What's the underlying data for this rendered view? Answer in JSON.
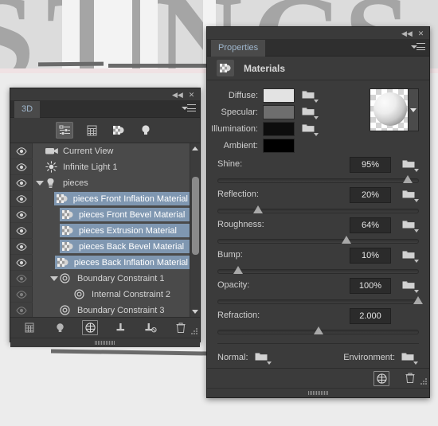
{
  "app": {
    "canvas_letters": [
      "S",
      "T",
      "I",
      "N",
      "G",
      "S"
    ]
  },
  "panel3d": {
    "tab_label": "3D",
    "titlebar": {
      "collapse": "◀◀",
      "close": "✕"
    },
    "filters": [
      {
        "name": "scene-filter-icon",
        "label": "Scene",
        "selected": true
      },
      {
        "name": "mesh-filter-icon",
        "label": "Meshes",
        "selected": false
      },
      {
        "name": "materials-filter-icon",
        "label": "Materials",
        "selected": false
      },
      {
        "name": "lights-filter-icon",
        "label": "Lights",
        "selected": false
      }
    ],
    "rows": [
      {
        "label": "Current View",
        "icon": "camera-icon",
        "type": "normal",
        "indent": 0,
        "visible": true,
        "disclosure": false
      },
      {
        "label": "Infinite Light 1",
        "icon": "light-icon",
        "type": "normal",
        "indent": 0,
        "visible": true,
        "disclosure": false
      },
      {
        "label": "pieces",
        "icon": "mesh-icon",
        "type": "normal",
        "indent": 0,
        "visible": true,
        "disclosure": true
      },
      {
        "label": "pieces Front Inflation Material",
        "icon": "material-icon",
        "type": "material",
        "indent": 1,
        "visible": true,
        "disclosure": false
      },
      {
        "label": "pieces Front Bevel Material",
        "icon": "material-icon",
        "type": "material",
        "indent": 1,
        "visible": true,
        "disclosure": false
      },
      {
        "label": "pieces Extrusion Material",
        "icon": "material-icon",
        "type": "material",
        "indent": 1,
        "visible": true,
        "disclosure": false
      },
      {
        "label": "pieces Back Bevel Material",
        "icon": "material-icon",
        "type": "material",
        "indent": 1,
        "visible": true,
        "disclosure": false
      },
      {
        "label": "pieces Back Inflation Material",
        "icon": "material-icon",
        "type": "material",
        "indent": 1,
        "visible": true,
        "disclosure": false
      },
      {
        "label": "Boundary Constraint 1",
        "icon": "constraint-icon",
        "type": "dim",
        "indent": 1,
        "visible": true,
        "disclosure": true
      },
      {
        "label": "Internal Constraint 2",
        "icon": "constraint-icon",
        "type": "dim",
        "indent": 2,
        "visible": true,
        "disclosure": false
      },
      {
        "label": "Boundary Constraint 3",
        "icon": "constraint-icon",
        "type": "dim",
        "indent": 1,
        "visible": true,
        "disclosure": false
      }
    ],
    "bottom_tools": [
      {
        "name": "add-mesh-icon",
        "label": "Add Mesh",
        "selected": false
      },
      {
        "name": "add-light-icon",
        "label": "Add Light",
        "selected": false
      },
      {
        "name": "environment-icon",
        "label": "Environment",
        "selected": true
      },
      {
        "name": "add-constraint-icon",
        "label": "Add Constraint",
        "selected": false
      },
      {
        "name": "remove-constraint-icon",
        "label": "Remove Constraint",
        "selected": false
      },
      {
        "name": "delete-icon",
        "label": "Delete",
        "selected": false
      }
    ]
  },
  "properties": {
    "tab_label": "Properties",
    "titlebar": {
      "collapse": "◀◀",
      "close": "✕"
    },
    "section_title": "Materials",
    "colors": [
      {
        "label": "Diffuse:",
        "value": "#e3e3e3",
        "has_folder": true
      },
      {
        "label": "Specular:",
        "value": "#6e6e6e",
        "has_folder": true
      },
      {
        "label": "Illumination:",
        "value": "#0d0d0d",
        "has_folder": true
      },
      {
        "label": "Ambient:",
        "value": "#000000",
        "has_folder": false
      }
    ],
    "sliders": [
      {
        "label": "Shine:",
        "value": "95%",
        "percent": 95,
        "has_folder": true
      },
      {
        "label": "Reflection:",
        "value": "20%",
        "percent": 20,
        "has_folder": true
      },
      {
        "label": "Roughness:",
        "value": "64%",
        "percent": 64,
        "has_folder": true
      },
      {
        "label": "Bump:",
        "value": "10%",
        "percent": 10,
        "has_folder": true
      },
      {
        "label": "Opacity:",
        "value": "100%",
        "percent": 100,
        "has_folder": true
      },
      {
        "label": "Refraction:",
        "value": "2.000",
        "percent": 50,
        "has_folder": false
      }
    ],
    "maps": {
      "normal_label": "Normal:",
      "environment_label": "Environment:"
    },
    "bottom_tools": [
      {
        "name": "new-material-icon",
        "label": "New Material",
        "selected": true
      },
      {
        "name": "delete-icon",
        "label": "Delete",
        "selected": false
      }
    ],
    "preview": {
      "name": "material-sphere-preview",
      "label": "Material Preview"
    }
  }
}
